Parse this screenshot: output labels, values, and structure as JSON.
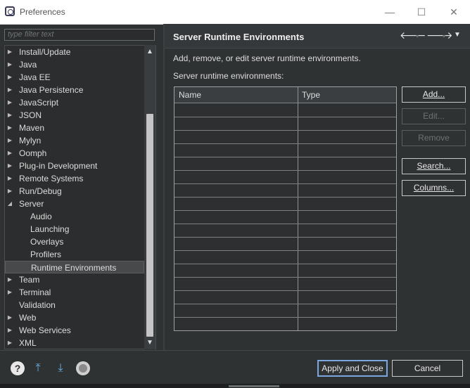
{
  "window": {
    "title": "Preferences",
    "minimize": "—",
    "maximize": "☐",
    "close": "✕"
  },
  "filter": {
    "placeholder": "type filter text"
  },
  "tree": {
    "items": [
      {
        "label": "Install/Update",
        "arrow": "▶",
        "indent": 0
      },
      {
        "label": "Java",
        "arrow": "▶",
        "indent": 0
      },
      {
        "label": "Java EE",
        "arrow": "▶",
        "indent": 0
      },
      {
        "label": "Java Persistence",
        "arrow": "▶",
        "indent": 0
      },
      {
        "label": "JavaScript",
        "arrow": "▶",
        "indent": 0
      },
      {
        "label": "JSON",
        "arrow": "▶",
        "indent": 0
      },
      {
        "label": "Maven",
        "arrow": "▶",
        "indent": 0
      },
      {
        "label": "Mylyn",
        "arrow": "▶",
        "indent": 0
      },
      {
        "label": "Oomph",
        "arrow": "▶",
        "indent": 0
      },
      {
        "label": "Plug-in Development",
        "arrow": "▶",
        "indent": 0
      },
      {
        "label": "Remote Systems",
        "arrow": "▶",
        "indent": 0
      },
      {
        "label": "Run/Debug",
        "arrow": "▶",
        "indent": 0
      },
      {
        "label": "Server",
        "arrow": "◢",
        "indent": 0
      },
      {
        "label": "Audio",
        "arrow": "",
        "indent": 1
      },
      {
        "label": "Launching",
        "arrow": "",
        "indent": 1
      },
      {
        "label": "Overlays",
        "arrow": "",
        "indent": 1
      },
      {
        "label": "Profilers",
        "arrow": "",
        "indent": 1
      },
      {
        "label": "Runtime Environments",
        "arrow": "",
        "indent": 1,
        "selected": true
      },
      {
        "label": "Team",
        "arrow": "▶",
        "indent": 0
      },
      {
        "label": "Terminal",
        "arrow": "▶",
        "indent": 0
      },
      {
        "label": "Validation",
        "arrow": "",
        "indent": 0
      },
      {
        "label": "Web",
        "arrow": "▶",
        "indent": 0
      },
      {
        "label": "Web Services",
        "arrow": "▶",
        "indent": 0
      },
      {
        "label": "XML",
        "arrow": "▶",
        "indent": 0
      }
    ],
    "scroll_up": "▲",
    "scroll_down": "▼"
  },
  "page": {
    "title": "Server Runtime Environments",
    "description": "Add, remove, or edit server runtime environments.",
    "list_label": "Server runtime environments:",
    "nav": {
      "back": "🡐",
      "forward": "🡒",
      "menu": "▼",
      "dropdown": "▾"
    },
    "table": {
      "columns": [
        "Name",
        "Type"
      ],
      "row_count": 17
    },
    "buttons": {
      "add": "Add...",
      "edit": "Edit...",
      "remove": "Remove",
      "search": "Search...",
      "columns": "Columns..."
    }
  },
  "footer": {
    "help": "?",
    "import": "⤒",
    "export": "⤓",
    "apply_close": "Apply and Close",
    "cancel": "Cancel"
  }
}
